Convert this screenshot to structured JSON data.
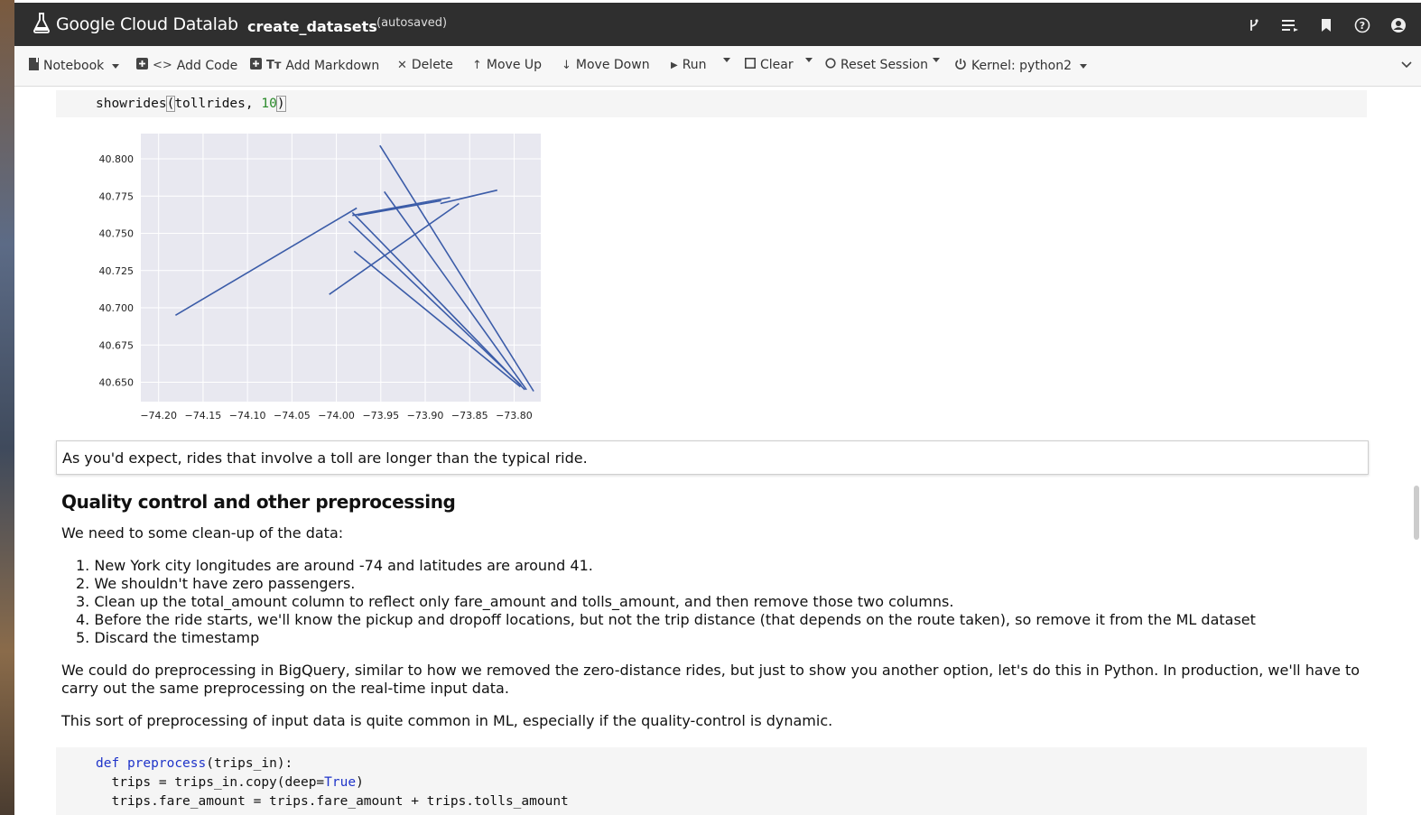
{
  "app": {
    "brand": "Google Cloud Datalab",
    "notebook_title": "create_datasets",
    "autosave_status": "(autosaved)",
    "top_icons": [
      "branch-icon",
      "list-icon",
      "bookmark-icon",
      "help-icon",
      "account-icon"
    ]
  },
  "toolbar": {
    "notebook": "Notebook",
    "add_code": "Add Code",
    "add_markdown": "Add Markdown",
    "delete": "Delete",
    "move_up": "Move Up",
    "move_down": "Move Down",
    "run": "Run",
    "clear": "Clear",
    "reset_session": "Reset Session",
    "kernel": "Kernel: python2"
  },
  "code_cell_1": {
    "fn": "showrides",
    "arg": "tollrides",
    "sep": ", ",
    "num": "10"
  },
  "chart_data": {
    "type": "line",
    "title": "",
    "xlabel": "",
    "ylabel": "",
    "xlim": [
      -74.22,
      -73.77
    ],
    "ylim": [
      40.637,
      40.817
    ],
    "grid": true,
    "x_ticks": [
      -74.2,
      -74.15,
      -74.1,
      -74.05,
      -74.0,
      -73.95,
      -73.9,
      -73.85,
      -73.8
    ],
    "x_tick_labels": [
      "−74.20",
      "−74.15",
      "−74.10",
      "−74.05",
      "−74.00",
      "−73.95",
      "−73.90",
      "−73.85",
      "−73.80"
    ],
    "y_ticks": [
      40.65,
      40.675,
      40.7,
      40.725,
      40.75,
      40.775,
      40.8
    ],
    "y_tick_labels": [
      "40.650",
      "40.675",
      "40.700",
      "40.725",
      "40.750",
      "40.775",
      "40.800"
    ],
    "line_color": "#3b5ca8",
    "series": [
      {
        "x": [
          -74.181,
          -73.977
        ],
        "y": [
          40.695,
          40.767
        ]
      },
      {
        "x": [
          -73.951,
          -73.778
        ],
        "y": [
          40.809,
          40.644
        ]
      },
      {
        "x": [
          -73.946,
          -73.786
        ],
        "y": [
          40.778,
          40.645
        ]
      },
      {
        "x": [
          -73.982,
          -73.788
        ],
        "y": [
          40.764,
          40.645
        ]
      },
      {
        "x": [
          -73.986,
          -73.792
        ],
        "y": [
          40.758,
          40.648
        ]
      },
      {
        "x": [
          -73.98,
          -73.793
        ],
        "y": [
          40.738,
          40.647
        ]
      },
      {
        "x": [
          -74.008,
          -73.862
        ],
        "y": [
          40.709,
          40.77
        ]
      },
      {
        "x": [
          -73.982,
          -73.872
        ],
        "y": [
          40.762,
          40.774
        ]
      },
      {
        "x": [
          -73.976,
          -73.882
        ],
        "y": [
          40.762,
          40.772
        ]
      },
      {
        "x": [
          -73.883,
          -73.819
        ],
        "y": [
          40.77,
          40.779
        ]
      }
    ]
  },
  "markdown": {
    "note": "As you'd expect, rides that involve a toll are longer than the typical ride.",
    "heading": "Quality control and other preprocessing",
    "intro": "We need to some clean-up of the data:",
    "list": [
      "New York city longitudes are around -74 and latitudes are around 41.",
      "We shouldn't have zero passengers.",
      "Clean up the total_amount column to reflect only fare_amount and tolls_amount, and then remove those two columns.",
      "Before the ride starts, we'll know the pickup and dropoff locations, but not the trip distance (that depends on the route taken), so remove it from the ML dataset",
      "Discard the timestamp"
    ],
    "para1": "We could do preprocessing in BigQuery, similar to how we removed the zero-distance rides, but just to show you another option, let's do this in Python. In production, we'll have to carry out the same preprocessing on the real-time input data.",
    "para2": "This sort of preprocessing of input data is quite common in ML, especially if the quality-control is dynamic."
  },
  "code_cell_2": {
    "def_kw": "def",
    "fn_name": "preprocess",
    "sig_rest": "(trips_in):",
    "line2_a": "  trips = trips_in.copy(deep=",
    "line2_true": "True",
    "line2_b": ")",
    "line3": "  trips.fare_amount = trips.fare_amount + trips.tolls_amount"
  }
}
